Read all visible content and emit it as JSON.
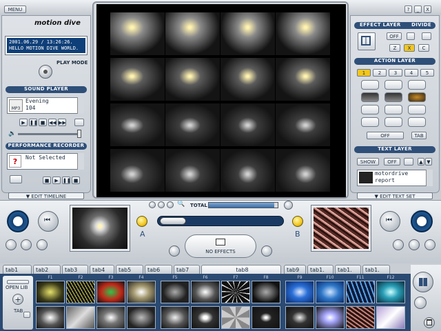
{
  "app": {
    "menu_label": "MENU",
    "logo": "motion dive",
    "top_buttons": [
      "?",
      "_",
      "X"
    ]
  },
  "left": {
    "lcd_lines": [
      "2001.06.29 / 13:26:26.",
      "HELLO MOTION DIVE WORLD."
    ],
    "play_mode_label": "PLAY MODE",
    "sound_player": {
      "header": "SOUND PLAYER",
      "icon_text": "MP3",
      "track": "Evening",
      "number": "104",
      "transport": [
        "▶",
        "❚❚",
        "■",
        "◀◀",
        "▶▶"
      ]
    },
    "recorder": {
      "header": "PERFORMANCE RECORDER",
      "status": "Not Selected",
      "controls": [
        "■",
        "▶",
        "❚❚",
        "■"
      ]
    },
    "edit_timeline": "▼ EDIT TIMELINE"
  },
  "right": {
    "effect": {
      "header": "EFFECT LAYER",
      "divide": "DIVIDE",
      "off": "OFF",
      "keys": [
        "Z",
        "X",
        "C"
      ]
    },
    "action": {
      "header": "ACTION LAYER",
      "nums": [
        "1",
        "2",
        "3",
        "4",
        "5"
      ],
      "off": "OFF",
      "tab": "TAB"
    },
    "text": {
      "header": "TEXT LAYER",
      "show": "SHOW",
      "off": "OFF",
      "line1": "motordrive",
      "line2": "report"
    },
    "edit_text_set": "▼ EDIT TEXT SET"
  },
  "mixer": {
    "total_label": "TOTAL",
    "a_label": "A",
    "b_label": "B",
    "effect_label": "NO EFFECTS",
    "total_level": 0.95
  },
  "bottom": {
    "tabs": [
      "tab1",
      "tab2",
      "tab3",
      "tab4",
      "tab5",
      "tab6",
      "tab7",
      "tab8",
      "tab9",
      "tab1.",
      "tab1.",
      "tab1."
    ],
    "open_lib": "OPEN LIB",
    "tab_label": "TAB",
    "fkeys": [
      "F1",
      "F2",
      "F3",
      "F4",
      "F5",
      "F6",
      "F7",
      "F8",
      "F9",
      "F10",
      "F11",
      "F12"
    ]
  }
}
